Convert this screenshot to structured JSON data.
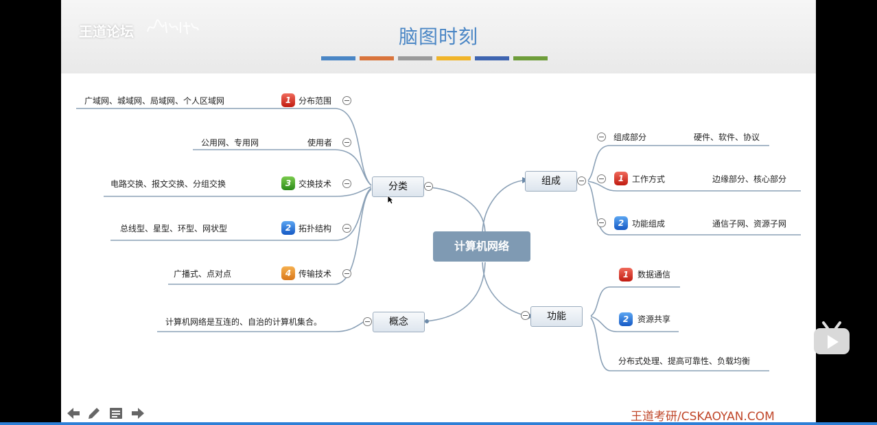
{
  "header": {
    "watermark": "王道论坛",
    "title": "脑图时刻",
    "bar_colors": [
      "#4a86c5",
      "#d9743c",
      "#9a9a9a",
      "#f0b429",
      "#3e64b0",
      "#6e9d3a"
    ]
  },
  "mindmap": {
    "center": "计算机网络",
    "branches": {
      "classify": {
        "label": "分类",
        "children": [
          {
            "label": "分布范围",
            "badge": "1",
            "detail": "广域网、城域网、局域网、个人区域网"
          },
          {
            "label": "使用者",
            "badge": "",
            "detail": "公用网、专用网"
          },
          {
            "label": "交换技术",
            "badge": "3",
            "detail": "电路交换、报文交换、分组交换"
          },
          {
            "label": "拓扑结构",
            "badge": "2",
            "detail": "总线型、星型、环型、网状型"
          },
          {
            "label": "传输技术",
            "badge": "4",
            "detail": "广播式、点对点"
          }
        ]
      },
      "concept": {
        "label": "概念",
        "detail": "计算机网络是互连的、自治的计算机集合。"
      },
      "composition": {
        "label": "组成",
        "children": [
          {
            "label": "组成部分",
            "badge": "",
            "detail": "硬件、软件、协议"
          },
          {
            "label": "工作方式",
            "badge": "1",
            "detail": "边缘部分、核心部分"
          },
          {
            "label": "功能组成",
            "badge": "2",
            "detail": "通信子网、资源子网"
          }
        ]
      },
      "function": {
        "label": "功能",
        "children": [
          {
            "label": "数据通信",
            "badge": "1"
          },
          {
            "label": "资源共享",
            "badge": "2"
          },
          {
            "label": "分布式处理、提高可靠性、负载均衡",
            "badge": ""
          }
        ]
      }
    }
  },
  "footer": {
    "brand": "王道考研/CSKAOYAN.COM"
  },
  "icons": [
    "arrow-left-icon",
    "pencil-icon",
    "menu-icon",
    "arrow-right-icon",
    "bilibili-play-icon"
  ]
}
